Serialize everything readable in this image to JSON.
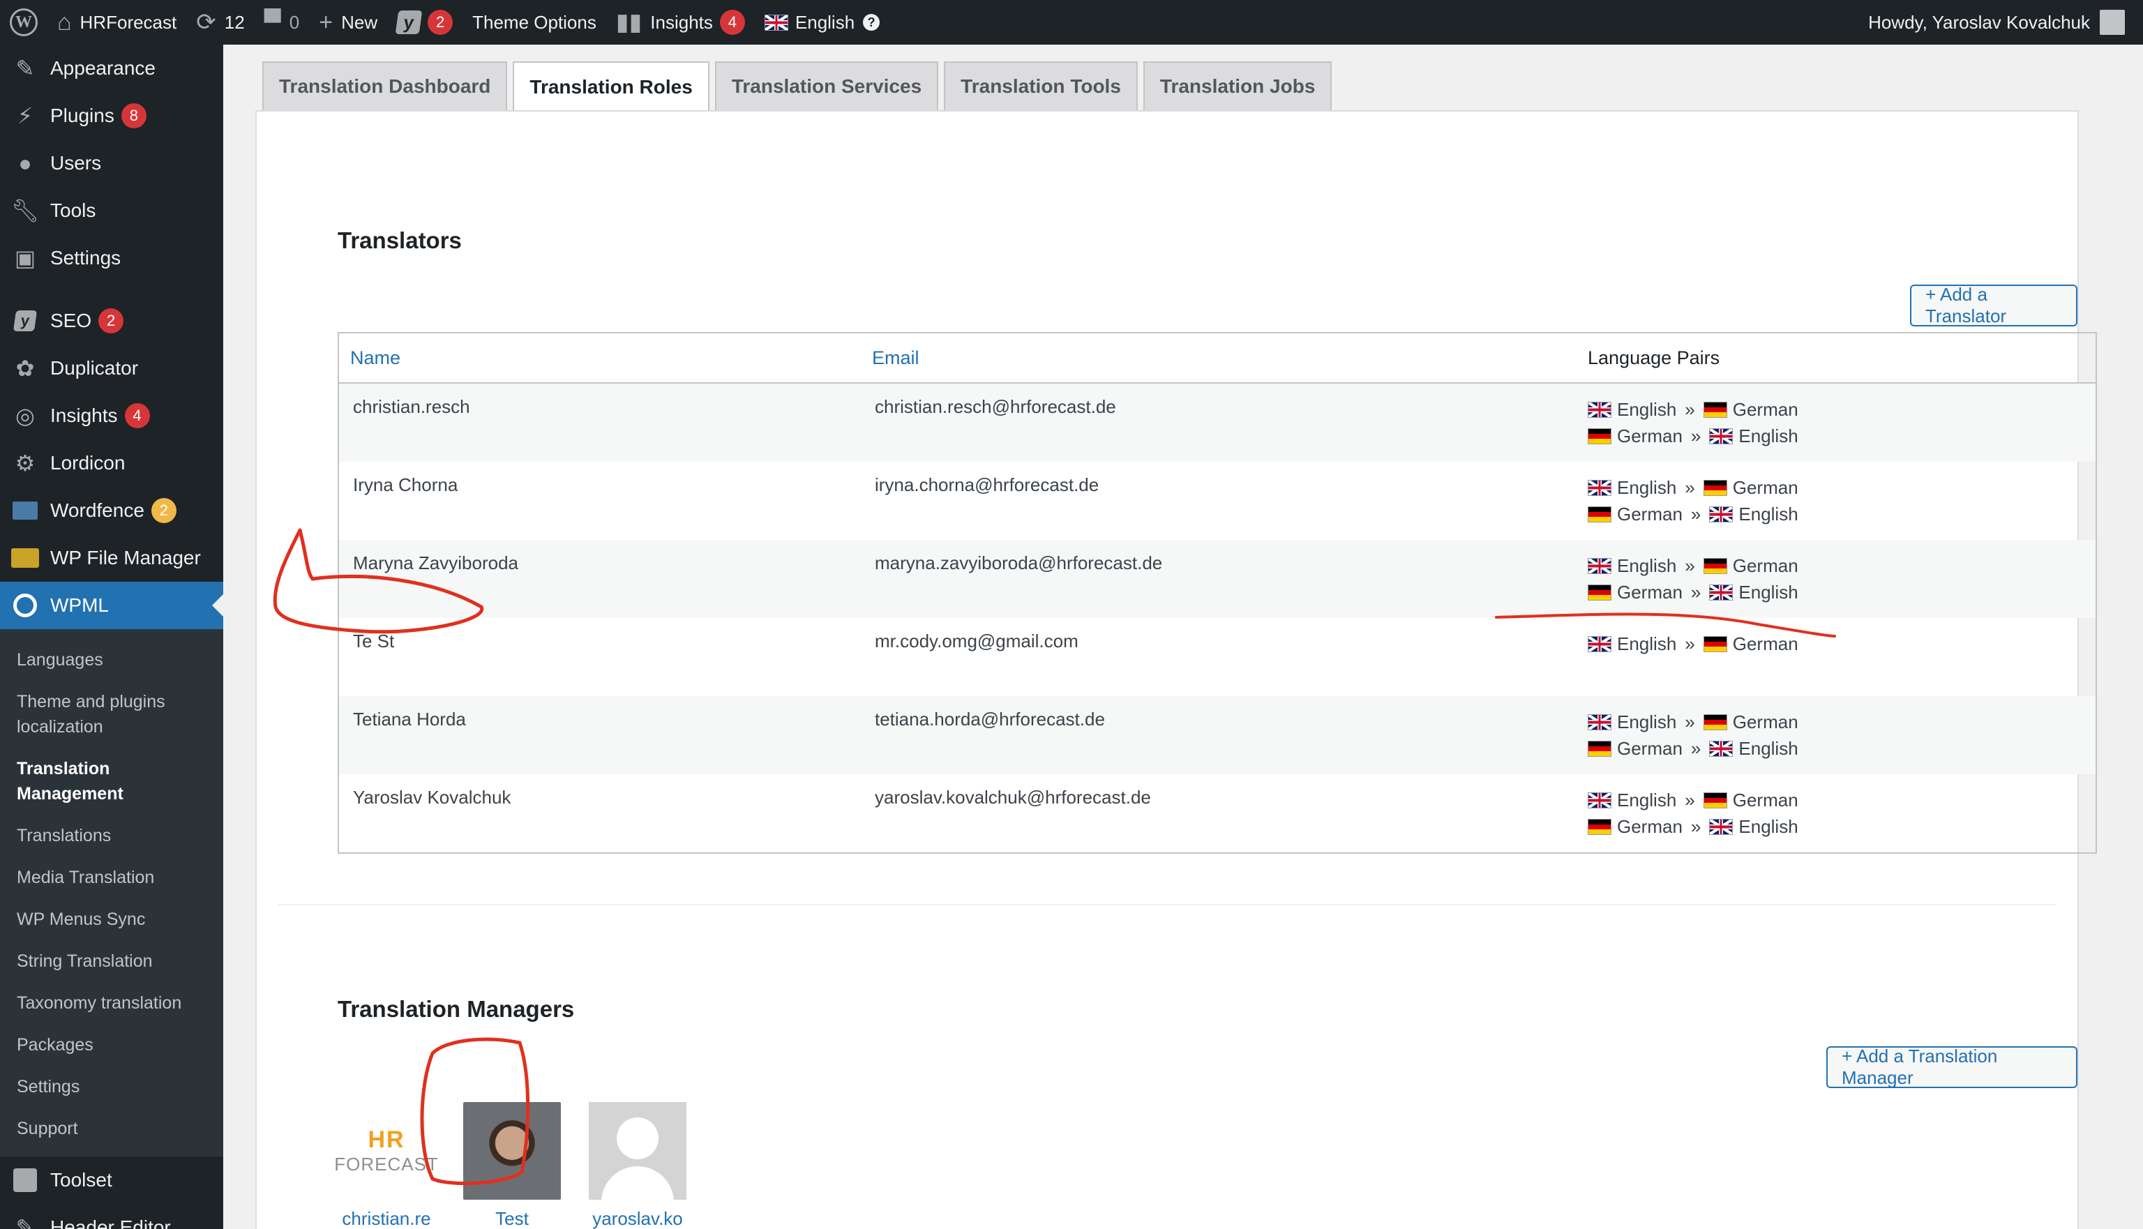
{
  "adminbar": {
    "site_name": "HRForecast",
    "updates_count": "12",
    "comments_count": "0",
    "new_label": "New",
    "yoast_count": "2",
    "theme_options": "Theme Options",
    "insights_label": "Insights",
    "insights_count": "4",
    "language": "English",
    "greeting": "Howdy, Yaroslav Kovalchuk"
  },
  "sidebar": {
    "items": [
      {
        "label": "Appearance",
        "icon": "paintbrush-icon"
      },
      {
        "label": "Plugins",
        "icon": "plug-icon",
        "badge": "8"
      },
      {
        "label": "Users",
        "icon": "user-icon"
      },
      {
        "label": "Tools",
        "icon": "wrench-icon"
      },
      {
        "label": "Settings",
        "icon": "sliders-icon"
      },
      {
        "label": "SEO",
        "icon": "yoast-icon",
        "badge": "2"
      },
      {
        "label": "Duplicator",
        "icon": "duplicator-icon"
      },
      {
        "label": "Insights",
        "icon": "insights-icon",
        "badge": "4"
      },
      {
        "label": "Lordicon",
        "icon": "gear-icon"
      },
      {
        "label": "Wordfence",
        "icon": "wordfence-icon",
        "badge": "2"
      },
      {
        "label": "WP File Manager",
        "icon": "folder-icon"
      },
      {
        "label": "WPML",
        "icon": "wpml-icon"
      }
    ],
    "submenu": [
      "Languages",
      "Theme and plugins localization",
      "Translation Management",
      "Translations",
      "Media Translation",
      "WP Menus Sync",
      "String Translation",
      "Taxonomy translation",
      "Packages",
      "Settings",
      "Support"
    ],
    "bottom": [
      {
        "label": "Toolset",
        "icon": "toolset-icon"
      },
      {
        "label": "Header Editor",
        "icon": "pencil-icon"
      }
    ]
  },
  "tabs": [
    "Translation Dashboard",
    "Translation Roles",
    "Translation Services",
    "Translation Tools",
    "Translation Jobs"
  ],
  "translators": {
    "title": "Translators",
    "add_button": "+ Add a Translator",
    "columns": {
      "name": "Name",
      "email": "Email",
      "pairs": "Language Pairs"
    },
    "pair_separator": "»",
    "rows": [
      {
        "name": "christian.resch",
        "email": "christian.resch@hrforecast.de",
        "pairs": [
          [
            "English",
            "German"
          ],
          [
            "German",
            "English"
          ]
        ]
      },
      {
        "name": "Iryna Chorna",
        "email": "iryna.chorna@hrforecast.de",
        "pairs": [
          [
            "English",
            "German"
          ],
          [
            "German",
            "English"
          ]
        ]
      },
      {
        "name": "Maryna Zavyiboroda",
        "email": "maryna.zavyiboroda@hrforecast.de",
        "pairs": [
          [
            "English",
            "German"
          ],
          [
            "German",
            "English"
          ]
        ]
      },
      {
        "name": "Te St",
        "email": "mr.cody.omg@gmail.com",
        "pairs": [
          [
            "English",
            "German"
          ]
        ]
      },
      {
        "name": "Tetiana Horda",
        "email": "tetiana.horda@hrforecast.de",
        "pairs": [
          [
            "English",
            "German"
          ],
          [
            "German",
            "English"
          ]
        ]
      },
      {
        "name": "Yaroslav Kovalchuk",
        "email": "yaroslav.kovalchuk@hrforecast.de",
        "pairs": [
          [
            "English",
            "German"
          ],
          [
            "German",
            "English"
          ]
        ]
      }
    ]
  },
  "managers": {
    "title": "Translation Managers",
    "add_button": "+ Add a Translation Manager",
    "list": [
      {
        "name": "christian.resch",
        "avatar": "hr-forecast-logo",
        "logo_top": "HR",
        "logo_bottom": "FORECAST"
      },
      {
        "name": "Test",
        "avatar": "photo"
      },
      {
        "name": "yaroslav.kovalchuk",
        "avatar": "placeholder"
      }
    ]
  },
  "colors": {
    "accent": "#2271b1",
    "adminbar": "#1d2327",
    "annotation": "#e0301e"
  }
}
